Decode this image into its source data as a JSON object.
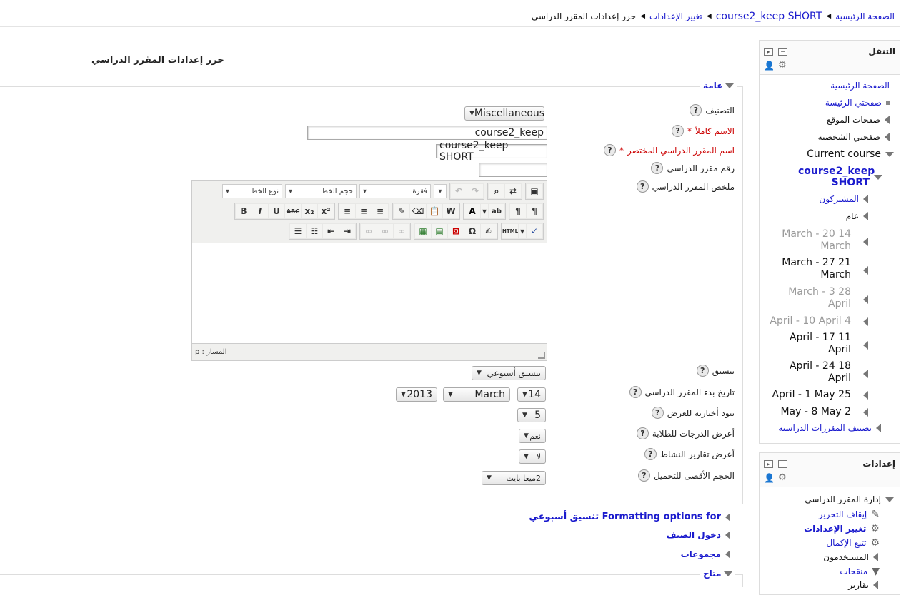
{
  "breadcrumb": {
    "items": [
      "الصفحة الرئيسية",
      "course2_keep SHORT",
      "تغيير الإعدادات",
      "حرر إعدادات المقرر الدراسي"
    ]
  },
  "page_title": "حرر إعدادات المقرر الدراسي",
  "general": {
    "legend": "عامة",
    "category_label": "التصنيف",
    "category_value": "Miscellaneous",
    "fullname_label": "الاسم كاملاً",
    "fullname_value": "course2_keep",
    "shortname_label": "اسم المقرر الدراسي المختصر",
    "shortname_value": "course2_keep SHORT",
    "idnumber_label": "رقم مقرر الدراسي",
    "idnumber_value": "",
    "summary_label": "ملخص المقرر الدراسي",
    "format_label": "تنسيق",
    "format_value": "تنسيق أسبوعي",
    "startdate_label": "تاريخ بدء المقرر الدراسي",
    "startdate_day": "14",
    "startdate_month": "March",
    "startdate_year": "2013",
    "newsitems_label": "بنود أخباريه للعرض",
    "newsitems_value": "5",
    "showgrades_label": "أعرض الدرجات للطلابة",
    "showgrades_value": "نعم",
    "showreports_label": "أعرض تقارير النشاط",
    "showreports_value": "لا",
    "maxbytes_label": "الحجم الأقصى للتحميل",
    "maxbytes_value": "2ميغا بايت",
    "required_star": "*",
    "help_glyph": "?"
  },
  "editor": {
    "font_family": "نوع الخط",
    "font_size": "حجم الخط",
    "paragraph": "فقرة",
    "path_label": "المسار : p",
    "buttons_row1": [
      "B",
      "I",
      "U",
      "ABC",
      "x₂",
      "x²"
    ],
    "buttons_row3": [
      "Ω",
      "HTML"
    ]
  },
  "sections": {
    "formatting": "Formatting options for تنسيق أسبوعي",
    "guest": "دخول الضيف",
    "groups": "مجموعات",
    "availability": "متاح"
  },
  "navigation": {
    "title": "التنقل",
    "home": "الصفحة الرئيسية",
    "my_home": "صفحتي الرئيسة",
    "site_pages": "صفحات الموقع",
    "my_profile": "صفحتي الشخصية",
    "current_course": "Current course",
    "course_name": "course2_keep SHORT",
    "participants": "المشتركون",
    "general": "عام",
    "weeks": [
      {
        "line1": "March - 20 14",
        "line2": "March",
        "state": "grey"
      },
      {
        "line1": "March - 27 21",
        "line2": "March",
        "state": "dark"
      },
      {
        "line1": "March - 3 28",
        "line2": "April",
        "state": "grey"
      },
      {
        "line1": "April - 10 April 4",
        "line2": "",
        "state": "grey"
      },
      {
        "line1": "April - 17 11",
        "line2": "April",
        "state": "dark"
      },
      {
        "line1": "April - 24 18",
        "line2": "April",
        "state": "dark"
      },
      {
        "line1": "April - 1 May 25",
        "line2": "",
        "state": "dark"
      },
      {
        "line1": "May - 8 May 2",
        "line2": "",
        "state": "dark"
      }
    ],
    "courses": "تصنيف المقررات الدراسية"
  },
  "settings": {
    "title": "إعدادات",
    "course_admin": "إدارة المقرر الدراسي",
    "turn_editing_off": "إيقاف التحرير",
    "edit_settings": "تغيير الإعدادات",
    "completion_tracking": "تتبع الإكمال",
    "users": "المستخدمون",
    "filters": "منقحات",
    "reports": "تقارير"
  }
}
